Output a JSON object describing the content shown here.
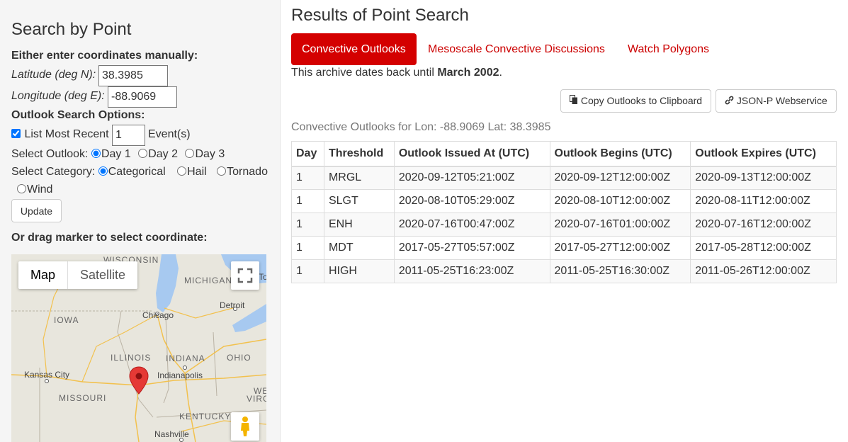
{
  "search": {
    "title": "Search by Point",
    "manual_label": "Either enter coordinates manually:",
    "lat_label": "Latitude (deg N):",
    "lat_value": "38.3985",
    "lon_label": "Longitude (deg E):",
    "lon_value": "-88.9069",
    "options_label": "Outlook Search Options:",
    "list_recent_label": "List Most Recent",
    "list_recent_checked": true,
    "event_count": "1",
    "events_suffix": "Event(s)",
    "outlook_label": "Select Outlook:",
    "outlook_options": [
      "Day 1",
      "Day 2",
      "Day 3"
    ],
    "outlook_selected": "Day 1",
    "category_label": "Select Category:",
    "category_options": [
      "Categorical",
      "Hail",
      "Tornado",
      "Wind"
    ],
    "category_selected": "Categorical",
    "update_button": "Update",
    "drag_label": "Or drag marker to select coordinate:"
  },
  "map": {
    "type_buttons": [
      "Map",
      "Satellite"
    ],
    "selected_type": "Map",
    "fullscreen_icon": "fullscreen-icon",
    "pegman_icon": "pegman-icon",
    "marker_icon": "map-pin-icon",
    "labels": {
      "wisconsin": "WISCONSIN",
      "michigan": "MICHIGAN",
      "to": "To",
      "detroit": "Detroit",
      "chicago": "Chicago",
      "iowa": "IOWA",
      "illinois": "ILLINOIS",
      "indiana": "INDIANA",
      "ohio": "OHIO",
      "kansas_city": "Kansas City",
      "indianapolis": "Indianapolis",
      "missouri": "MISSOURI",
      "we": "WE",
      "virg": "VIRG",
      "kentucky": "KENTUCKY",
      "nashville": "Nashville"
    }
  },
  "results": {
    "title": "Results of Point Search",
    "tabs": [
      "Convective Outlooks",
      "Mesoscale Convective Discussions",
      "Watch Polygons"
    ],
    "active_tab": "Convective Outlooks",
    "archive_prefix": "This archive dates back until ",
    "archive_date": "March 2002",
    "archive_suffix": ".",
    "copy_button": "Copy Outlooks to Clipboard",
    "json_button": "JSON-P Webservice",
    "caption": "Convective Outlooks for Lon: -88.9069 Lat: 38.3985",
    "columns": [
      "Day",
      "Threshold",
      "Outlook Issued At (UTC)",
      "Outlook Begins (UTC)",
      "Outlook Expires (UTC)"
    ],
    "rows": [
      [
        "1",
        "MRGL",
        "2020-09-12T05:21:00Z",
        "2020-09-12T12:00:00Z",
        "2020-09-13T12:00:00Z"
      ],
      [
        "1",
        "SLGT",
        "2020-08-10T05:29:00Z",
        "2020-08-10T12:00:00Z",
        "2020-08-11T12:00:00Z"
      ],
      [
        "1",
        "ENH",
        "2020-07-16T00:47:00Z",
        "2020-07-16T01:00:00Z",
        "2020-07-16T12:00:00Z"
      ],
      [
        "1",
        "MDT",
        "2017-05-27T05:57:00Z",
        "2017-05-27T12:00:00Z",
        "2017-05-28T12:00:00Z"
      ],
      [
        "1",
        "HIGH",
        "2011-05-25T16:23:00Z",
        "2011-05-25T16:30:00Z",
        "2011-05-26T12:00:00Z"
      ]
    ]
  },
  "colors": {
    "accent": "#d40000",
    "tab_link": "#cc0000",
    "water": "#a7c9f0",
    "land": "#e8e6dd",
    "marker": "#e53935"
  }
}
